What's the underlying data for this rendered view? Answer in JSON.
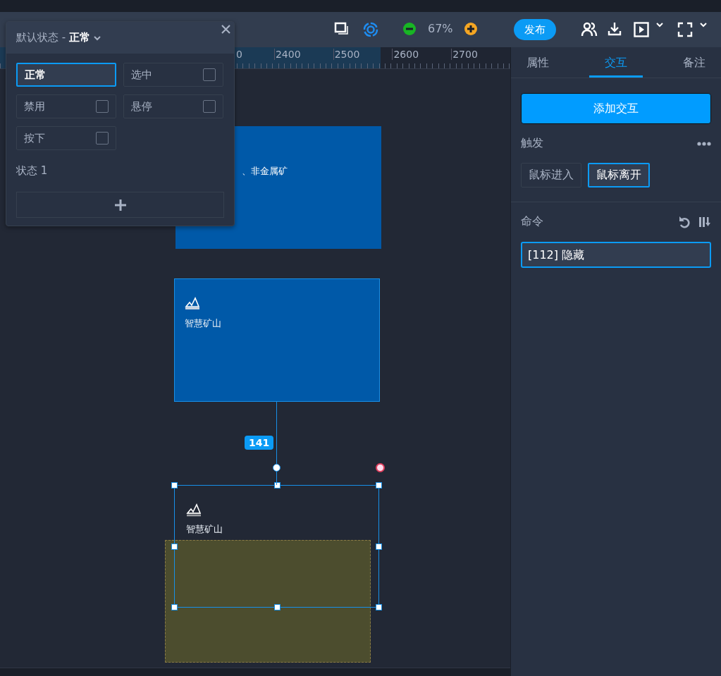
{
  "toolbar": {
    "zoom": "67%",
    "publish": "发布"
  },
  "ruler": {
    "labels": [
      "0",
      "2400",
      "2500",
      "2600",
      "2700"
    ]
  },
  "state_popover": {
    "title": "默认状态 - **正常**",
    "states": [
      {
        "label": "正常",
        "kind": "default",
        "selected": true
      },
      {
        "label": "选中",
        "kind": "checkbox",
        "selected": false,
        "checked": false
      },
      {
        "label": "禁用",
        "kind": "checkbox",
        "selected": false,
        "checked": false
      },
      {
        "label": "悬停",
        "kind": "checkbox",
        "selected": false,
        "checked": false
      },
      {
        "label": "按下",
        "kind": "checkbox",
        "selected": false,
        "checked": false
      }
    ],
    "custom_states": [
      "状态 1"
    ]
  },
  "canvas": {
    "widgets": [
      {
        "kind": "box",
        "label": "、非金属矿"
      },
      {
        "kind": "card",
        "label": "智慧矿山"
      },
      {
        "kind": "selected",
        "label": "智慧矿山"
      }
    ],
    "distance": "141"
  },
  "panel": {
    "tabs": [
      {
        "label": "属性",
        "selected": false
      },
      {
        "label": "交互",
        "selected": true
      },
      {
        "label": "备注",
        "selected": false
      }
    ],
    "add_button": "添加交互",
    "trigger_label": "触发",
    "triggers": [
      {
        "label": "鼠标进入",
        "selected": false
      },
      {
        "label": "鼠标离开",
        "selected": true
      }
    ],
    "command_label": "命令",
    "commands": [
      "[112] 隐藏"
    ]
  }
}
